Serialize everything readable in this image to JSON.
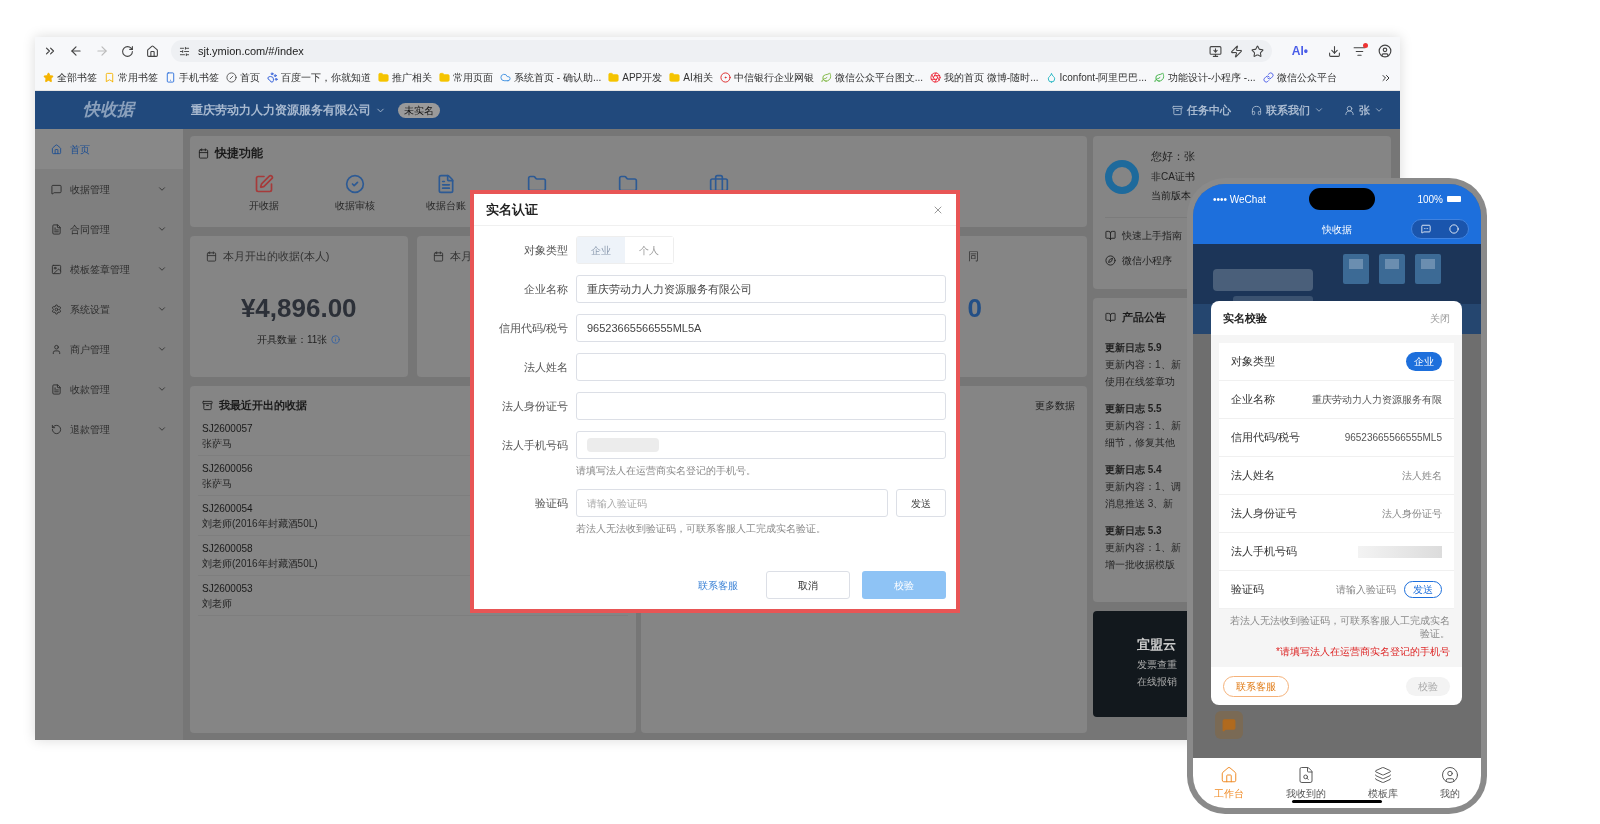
{
  "browser": {
    "url": "sjt.ymion.com/#/index",
    "ai_label": "AI•",
    "bookmarks": [
      "全部书签",
      "常用书签",
      "手机书签",
      "首页",
      "百度一下，你就知道",
      "推广相关",
      "常用页面",
      "系统首页 - 确认助...",
      "APP开发",
      "AI相关",
      "中信银行企业网银",
      "微信公众平台图文...",
      "我的首页 微博-随时...",
      "Iconfont-阿里巴巴...",
      "功能设计-小程序 -...",
      "微信公众平台"
    ]
  },
  "header": {
    "logo": "快收据",
    "company": "重庆劳动力人力资源服务有限公司",
    "badge": "未实名",
    "actions": [
      {
        "label": "任务中心",
        "dropdown": false
      },
      {
        "label": "联系我们",
        "dropdown": true
      },
      {
        "label": "张",
        "dropdown": true
      }
    ]
  },
  "sidebar": {
    "items": [
      {
        "label": "首页",
        "selected": true,
        "expandable": false
      },
      {
        "label": "收据管理",
        "selected": false,
        "expandable": true
      },
      {
        "label": "合同管理",
        "selected": false,
        "expandable": true
      },
      {
        "label": "模板签章管理",
        "selected": false,
        "expandable": true
      },
      {
        "label": "系统设置",
        "selected": false,
        "expandable": true
      },
      {
        "label": "商户管理",
        "selected": false,
        "expandable": true
      },
      {
        "label": "收款管理",
        "selected": false,
        "expandable": true
      },
      {
        "label": "退款管理",
        "selected": false,
        "expandable": true
      }
    ]
  },
  "quick_functions": {
    "title": "快捷功能",
    "items": [
      {
        "label": "开收据"
      },
      {
        "label": "收据审核"
      },
      {
        "label": "收据台账"
      }
    ]
  },
  "stat_cards": [
    {
      "title": "本月开出的收据(本人)",
      "value": "¥4,896.00",
      "note": "开具数量：11张"
    },
    {
      "title": "本月"
    },
    {
      "title": "同",
      "value": "0"
    }
  ],
  "recent": {
    "title": "我最近开出的收据",
    "rows": [
      {
        "code": "SJ2600057",
        "name": "张萨马"
      },
      {
        "code": "SJ2600056",
        "name": "张萨马"
      },
      {
        "code": "SJ2600054",
        "name": "刘老师(2016年封藏酒50L)"
      },
      {
        "code": "SJ2600058",
        "name": "刘老师(2016年封藏酒50L)"
      },
      {
        "code": "SJ2600053",
        "name": "刘老师"
      }
    ]
  },
  "second_panel": {
    "more": "更多数据"
  },
  "user_card": {
    "greeting": "您好：张",
    "cert": "非CA证书",
    "version": "当前版本",
    "links": [
      "快速上手指南",
      "微信小程序"
    ]
  },
  "announcements": {
    "title": "产品公告",
    "entries": [
      {
        "title": "更新日志 5.9",
        "lines": [
          "更新内容：1、新",
          "使用在线签章功"
        ]
      },
      {
        "title": "更新日志 5.5",
        "lines": [
          "更新内容：1、新",
          "细节，修复其他"
        ]
      },
      {
        "title": "更新日志 5.4",
        "lines": [
          "更新内容：1、调",
          "消息推送 3、新"
        ]
      },
      {
        "title": "更新日志 5.3",
        "lines": [
          "更新内容：1、新",
          "增一批收据模版"
        ]
      }
    ]
  },
  "ad": {
    "title": "宜盟云",
    "lines": [
      "发票查重",
      "在线报销"
    ]
  },
  "dialog": {
    "title": "实名认证",
    "type_label": "对象类型",
    "type_options": [
      {
        "label": "企业",
        "selected": true
      },
      {
        "label": "个人",
        "selected": false
      }
    ],
    "fields": [
      {
        "label": "企业名称",
        "value": "重庆劳动力人力资源服务有限公司"
      },
      {
        "label": "信用代码/税号",
        "value": "96523665566555ML5A"
      },
      {
        "label": "法人姓名"
      },
      {
        "label": "法人身份证号"
      },
      {
        "label": "法人手机号码",
        "masked": true,
        "hint": "请填写法人在运营商实名登记的手机号。"
      }
    ],
    "code": {
      "label": "验证码",
      "placeholder": "请输入验证码",
      "send": "发送",
      "hint": "若法人无法收到验证码，可联系客服人工完成实名验证。"
    },
    "contact": "联系客服",
    "cancel": "取消",
    "submit": "校验",
    "submit_disabled": true
  },
  "phone": {
    "carrier": "•••• WeChat",
    "battery": "100%",
    "title": "快收据",
    "modal": {
      "title": "实名校验",
      "close": "关闭",
      "type_label": "对象类型",
      "type_value": "企业",
      "fields": [
        {
          "label": "企业名称",
          "value": "重庆劳动力人力资源服务有限"
        },
        {
          "label": "信用代码/税号",
          "value": "96523665566555ML5"
        },
        {
          "label": "法人姓名",
          "placeholder": "法人姓名"
        },
        {
          "label": "法人身份证号",
          "placeholder": "法人身份证号"
        },
        {
          "label": "法人手机号码",
          "masked": true
        }
      ],
      "code": {
        "label": "验证码",
        "placeholder": "请输入验证码",
        "send": "发送"
      },
      "note": "若法人无法收到验证码，可联系客服人工完成实名验证。",
      "warning": "*请填写法人在运营商实名登记的手机号",
      "contact": "联系客服",
      "submit": "校验",
      "submit_disabled": true
    },
    "tabs": [
      {
        "label": "工作台",
        "selected": true
      },
      {
        "label": "我收到的",
        "selected": false
      },
      {
        "label": "模板库",
        "selected": false
      },
      {
        "label": "我的",
        "selected": false
      }
    ]
  }
}
